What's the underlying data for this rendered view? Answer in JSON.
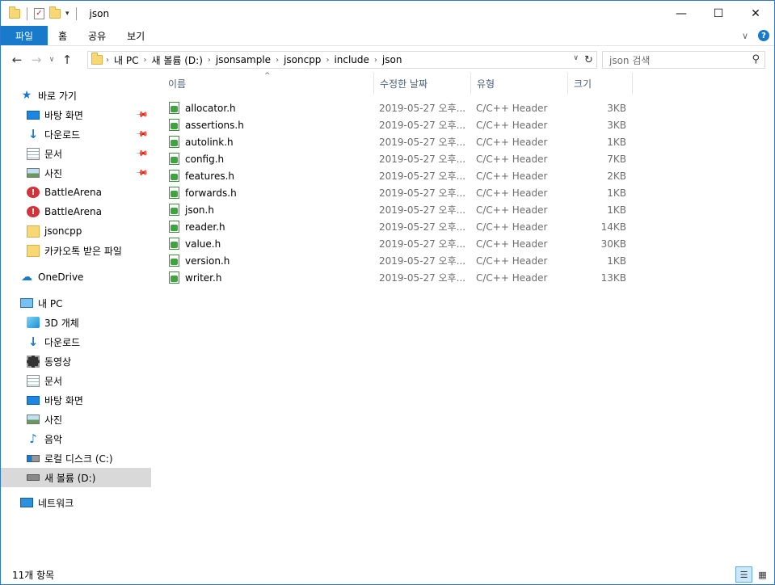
{
  "window": {
    "title": "json",
    "controls": {
      "minimize": "—",
      "maximize": "☐",
      "close": "✕"
    }
  },
  "ribbon": {
    "tabs": [
      "파일",
      "홈",
      "공유",
      "보기"
    ],
    "collapse_glyph": "∨",
    "help_glyph": "?"
  },
  "nav": {
    "back": "←",
    "forward": "→",
    "recent": "∨",
    "up": "↑",
    "breadcrumb": [
      "내 PC",
      "새 볼륨 (D:)",
      "jsonsample",
      "jsoncpp",
      "include",
      "json"
    ],
    "refresh": "↻",
    "search_placeholder": "json 검색",
    "search_icon": "⚲"
  },
  "sidebar": {
    "quick_access_label": "바로 가기",
    "quick_items": [
      {
        "label": "바탕 화면",
        "icon": "desktop-icon",
        "pinned": true
      },
      {
        "label": "다운로드",
        "icon": "download-icon",
        "pinned": true
      },
      {
        "label": "문서",
        "icon": "document-icon",
        "pinned": true
      },
      {
        "label": "사진",
        "icon": "pictures-icon",
        "pinned": true
      },
      {
        "label": "BattleArena",
        "icon": "error-folder-icon",
        "pinned": false
      },
      {
        "label": "BattleArena",
        "icon": "error-folder-icon",
        "pinned": false
      },
      {
        "label": "jsoncpp",
        "icon": "folder-icon",
        "pinned": false
      },
      {
        "label": "카카오톡 받은 파일",
        "icon": "folder-icon",
        "pinned": false
      }
    ],
    "onedrive_label": "OneDrive",
    "pc_label": "내 PC",
    "pc_items": [
      {
        "label": "3D 개체",
        "icon": "3d-objects-icon"
      },
      {
        "label": "다운로드",
        "icon": "download-icon"
      },
      {
        "label": "동영상",
        "icon": "video-icon"
      },
      {
        "label": "문서",
        "icon": "document-icon"
      },
      {
        "label": "바탕 화면",
        "icon": "desktop-icon"
      },
      {
        "label": "사진",
        "icon": "pictures-icon"
      },
      {
        "label": "음악",
        "icon": "music-icon"
      },
      {
        "label": "로컬 디스크 (C:)",
        "icon": "drive-c-icon"
      },
      {
        "label": "새 볼륨 (D:)",
        "icon": "drive-d-icon",
        "selected": true
      }
    ],
    "network_label": "네트워크"
  },
  "columns": {
    "name": "이름",
    "date": "수정한 날짜",
    "type": "유형",
    "size": "크기",
    "sort_glyph": "^"
  },
  "files": [
    {
      "name": "allocator.h",
      "date": "2019-05-27 오후...",
      "type": "C/C++ Header",
      "size": "3KB"
    },
    {
      "name": "assertions.h",
      "date": "2019-05-27 오후...",
      "type": "C/C++ Header",
      "size": "3KB"
    },
    {
      "name": "autolink.h",
      "date": "2019-05-27 오후...",
      "type": "C/C++ Header",
      "size": "1KB"
    },
    {
      "name": "config.h",
      "date": "2019-05-27 오후...",
      "type": "C/C++ Header",
      "size": "7KB"
    },
    {
      "name": "features.h",
      "date": "2019-05-27 오후...",
      "type": "C/C++ Header",
      "size": "2KB"
    },
    {
      "name": "forwards.h",
      "date": "2019-05-27 오후...",
      "type": "C/C++ Header",
      "size": "1KB"
    },
    {
      "name": "json.h",
      "date": "2019-05-27 오후...",
      "type": "C/C++ Header",
      "size": "1KB"
    },
    {
      "name": "reader.h",
      "date": "2019-05-27 오후...",
      "type": "C/C++ Header",
      "size": "14KB"
    },
    {
      "name": "value.h",
      "date": "2019-05-27 오후...",
      "type": "C/C++ Header",
      "size": "30KB"
    },
    {
      "name": "version.h",
      "date": "2019-05-27 오후...",
      "type": "C/C++ Header",
      "size": "1KB"
    },
    {
      "name": "writer.h",
      "date": "2019-05-27 오후...",
      "type": "C/C++ Header",
      "size": "13KB"
    }
  ],
  "status": {
    "item_count": "11개 항목"
  },
  "colors": {
    "accent": "#1979ca",
    "selected_row": "#d9d9d9",
    "header_text": "#4c607a"
  }
}
